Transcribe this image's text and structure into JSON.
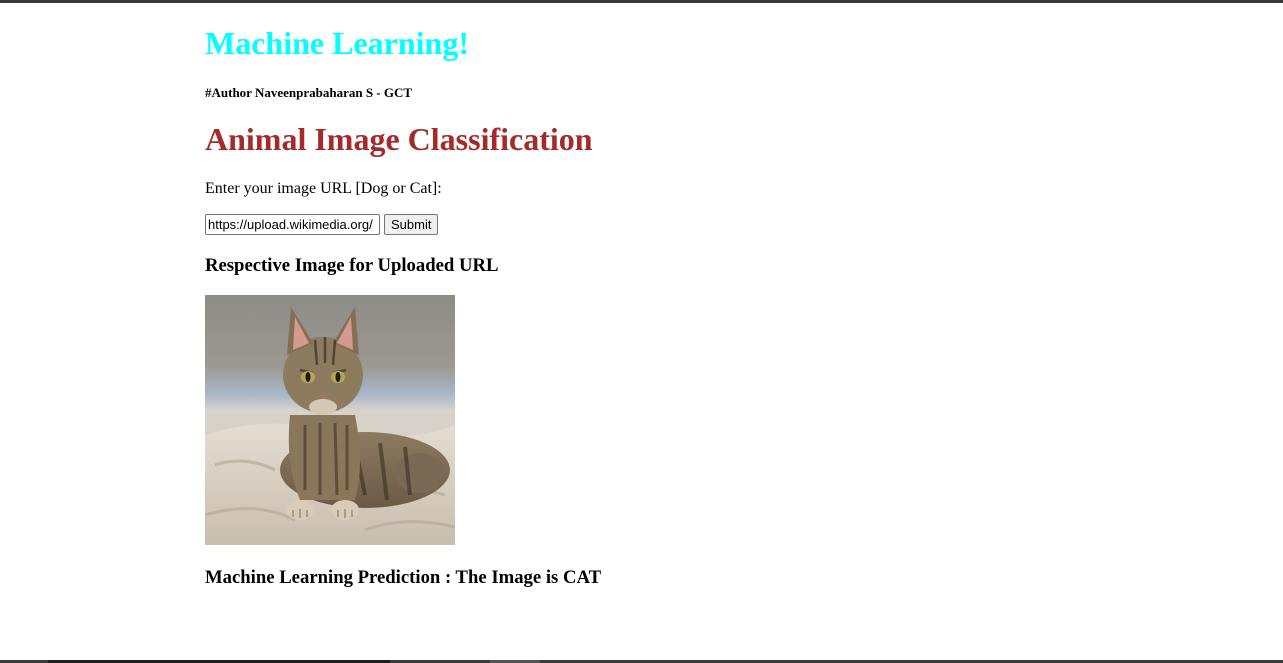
{
  "header": {
    "title": "Machine Learning!",
    "author": "#Author Naveenprabaharan S - GCT"
  },
  "main": {
    "heading": "Animal Image Classification",
    "prompt": "Enter your image URL [Dog or Cat]:",
    "url_input": {
      "value": "https://upload.wikimedia.org/"
    },
    "submit_label": "Submit",
    "image_section_heading": "Respective Image for Uploaded URL",
    "image_alt": "cat",
    "prediction": "Machine Learning Prediction : The Image is CAT"
  },
  "colors": {
    "title": "#00ffff",
    "heading": "#a52a2a"
  }
}
